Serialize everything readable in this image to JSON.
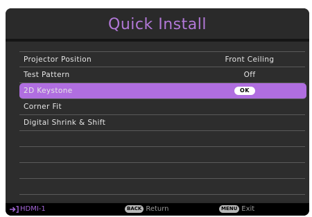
{
  "title": "Quick Install",
  "menu": {
    "items": [
      {
        "label": "Projector Position",
        "value": "Front Ceiling"
      },
      {
        "label": "Test Pattern",
        "value": "Off"
      },
      {
        "label": "2D Keystone",
        "value": "OK",
        "selected": true
      },
      {
        "label": "Corner Fit",
        "value": ""
      },
      {
        "label": "Digital Shrink & Shift",
        "value": ""
      },
      {
        "label": "",
        "value": ""
      },
      {
        "label": "",
        "value": ""
      },
      {
        "label": "",
        "value": ""
      },
      {
        "label": "",
        "value": ""
      }
    ]
  },
  "footer": {
    "source_icon": "input-arrow-icon",
    "source": "HDMI-1",
    "back_key": "BACK",
    "back_label": "Return",
    "menu_key": "MENU",
    "menu_label": "Exit"
  },
  "colors": {
    "accent": "#b06ee0",
    "title": "#b278d8",
    "background": "#2d2d2d"
  }
}
